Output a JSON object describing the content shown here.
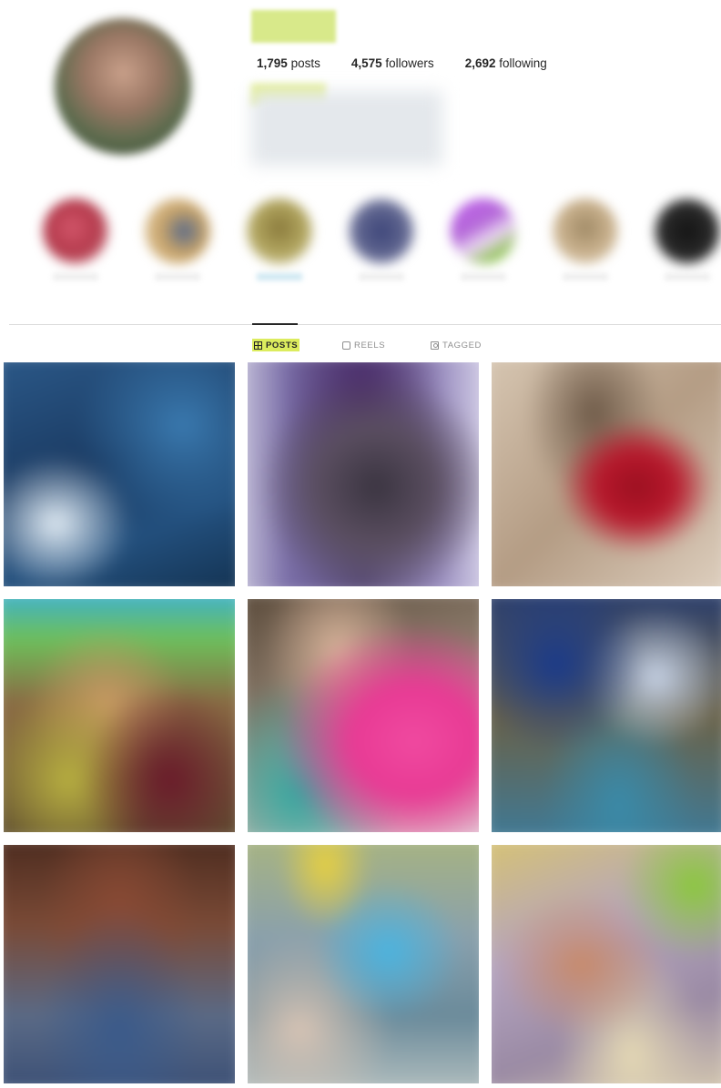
{
  "profile": {
    "avatar_icon": "profile-photo",
    "stats": {
      "posts_count": "1,795",
      "posts_label": "posts",
      "followers_count": "4,575",
      "followers_label": "followers",
      "following_count": "2,692",
      "following_label": "following"
    }
  },
  "highlights": {
    "items": [
      {
        "color": "#c6475a"
      },
      {
        "color": "#c8a46a"
      },
      {
        "color": "#a8a05c"
      },
      {
        "color": "#5e648e"
      },
      {
        "color": "#b468d8"
      },
      {
        "color": "#c8b08c"
      },
      {
        "color": "#2a2a2a"
      }
    ]
  },
  "tabs": {
    "posts": "POSTS",
    "reels": "REELS",
    "tagged": "TAGGED",
    "active": "posts"
  },
  "colors": {
    "highlight_accent": "#dcec5e",
    "text_primary": "#262626",
    "text_secondary": "#8e8e8e",
    "divider": "#dbdbdb"
  },
  "posts": {
    "count_visible": 9
  }
}
